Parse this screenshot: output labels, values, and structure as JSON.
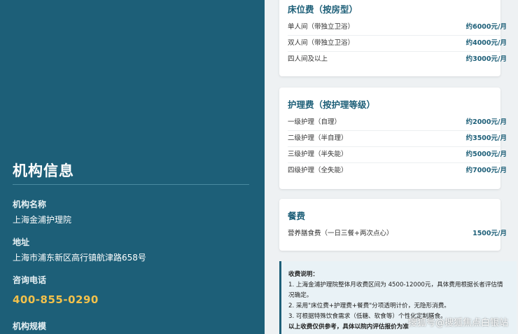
{
  "info": {
    "heading": "机构信息",
    "name_label": "机构名称",
    "name_value": "上海金浦护理院",
    "address_label": "地址",
    "address_value": "上海市浦东新区高行镇航津路658号",
    "phone_label": "咨询电话",
    "phone_value": "400-855-0290",
    "scale_label": "机构规模"
  },
  "bed": {
    "title": "床位费（按房型）",
    "items": [
      {
        "name": "单人间（带独立卫浴）",
        "price": "约6000元/月"
      },
      {
        "name": "双人间（带独立卫浴）",
        "price": "约4000元/月"
      },
      {
        "name": "四人间及以上",
        "price": "约3000元/月"
      }
    ]
  },
  "care": {
    "title": "护理费（按护理等级）",
    "items": [
      {
        "name": "一级护理（自理）",
        "price": "约2000元/月"
      },
      {
        "name": "二级护理（半自理）",
        "price": "约3500元/月"
      },
      {
        "name": "三级护理（半失能）",
        "price": "约5000元/月"
      },
      {
        "name": "四级护理（全失能）",
        "price": "约7000元/月"
      }
    ]
  },
  "meal": {
    "title": "餐费",
    "items": [
      {
        "name": "营养膳食费（一日三餐+两次点心）",
        "price": "1500元/月"
      }
    ]
  },
  "notice": {
    "title": "收费说明：",
    "line1a": "1. 上海金浦护理院整体月收费区间为 4500-12000元，具体费用根据长者评估情",
    "line1b": "况确定。",
    "line2": "2. 采用\"床位费+护理费+餐费\"分项透明计价，无隐形消费。",
    "line3": "3. 可根据特殊饮食需求（低糖、软食等）个性化定制膳食。",
    "line4": "以上收费仅供参考，具体以院内评估报价为准"
  },
  "watermark": "搜狐号@搜狐焦点白银站"
}
